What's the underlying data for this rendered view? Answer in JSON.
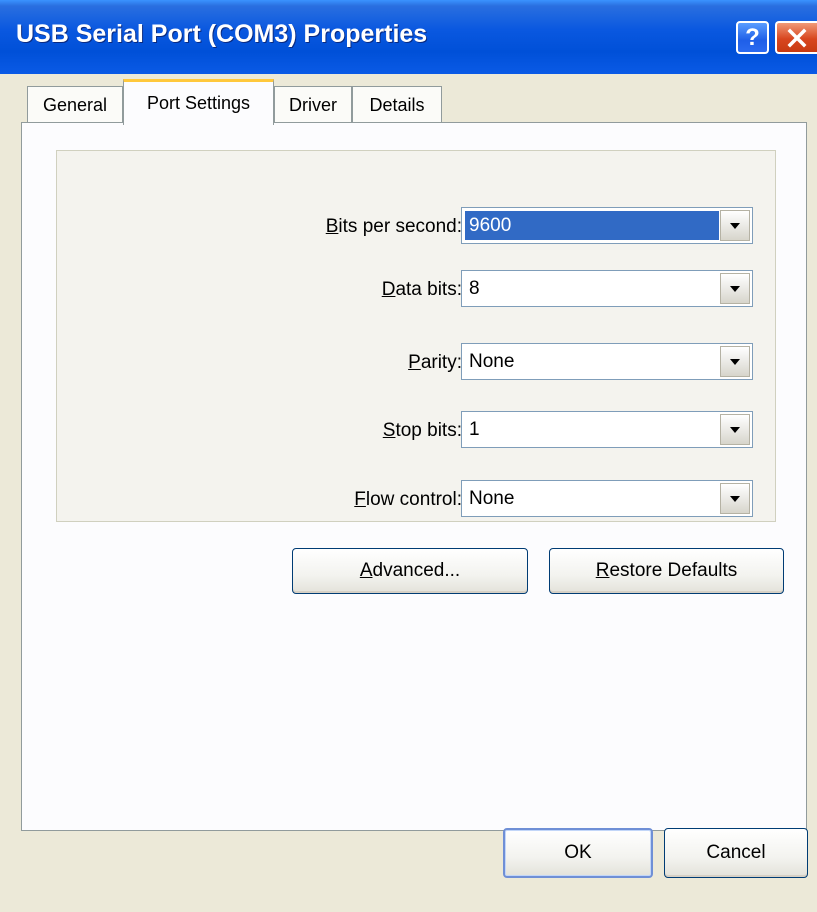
{
  "window": {
    "title": "USB Serial Port (COM3) Properties",
    "help_label": "?"
  },
  "tabs": [
    {
      "label": "General",
      "active": false
    },
    {
      "label": "Port Settings",
      "active": true
    },
    {
      "label": "Driver",
      "active": false
    },
    {
      "label": "Details",
      "active": false
    }
  ],
  "fields": {
    "bits_per_second": {
      "label_prefix": "B",
      "label_rest": "its per second:",
      "value": "9600"
    },
    "data_bits": {
      "label_prefix": "D",
      "label_rest": "ata bits:",
      "value": "8"
    },
    "parity": {
      "label_prefix": "P",
      "label_rest": "arity:",
      "value": "None"
    },
    "stop_bits": {
      "label_prefix": "S",
      "label_rest": "top bits:",
      "value": "1"
    },
    "flow_control": {
      "label_prefix": "F",
      "label_rest": "low control:",
      "value": "None"
    }
  },
  "buttons": {
    "advanced_prefix": "A",
    "advanced_rest": "dvanced...",
    "restore_prefix": "R",
    "restore_rest": "estore Defaults",
    "ok": "OK",
    "cancel": "Cancel"
  },
  "colors": {
    "titlebar": "#0050d8",
    "selection": "#316ac5",
    "dialog_bg": "#ece9d8"
  },
  "icons": [
    "help-icon",
    "close-icon",
    "chevron-down-icon"
  ]
}
